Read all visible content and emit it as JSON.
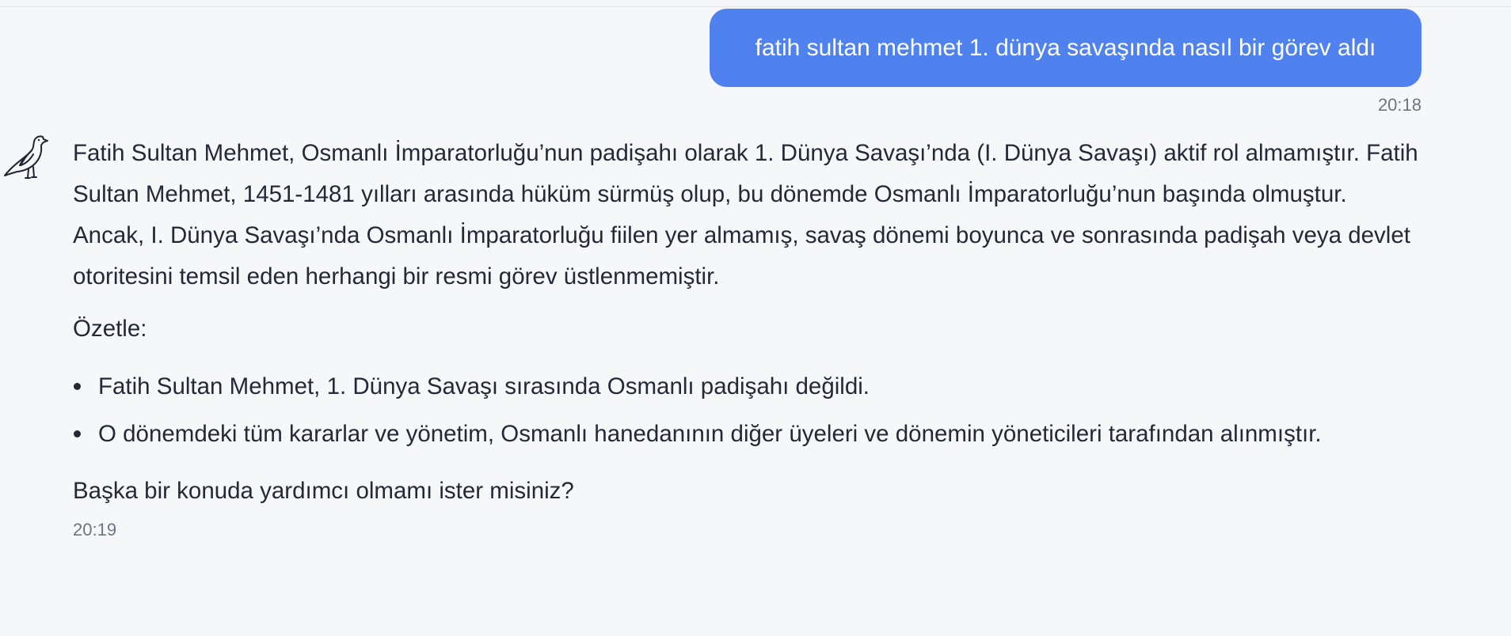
{
  "user_message": {
    "text": "fatih sultan mehmet 1. dünya savaşında nasıl bir görev aldı",
    "time": "20:18"
  },
  "assistant_message": {
    "avatar_icon": "bird-icon",
    "paragraph": "Fatih Sultan Mehmet, Osmanlı İmparatorluğu’nun padişahı olarak 1. Dünya Savaşı’nda (I. Dünya Savaşı) aktif rol almamıştır. Fatih Sultan Mehmet, 1451-1481 yılları arasında hüküm sürmüş olup, bu dönemde Osmanlı İmparatorluğu’nun başında olmuştur. Ancak, I. Dünya Savaşı’nda Osmanlı İmparatorluğu fiilen yer almamış, savaş dönemi boyunca ve sonrasında padişah veya devlet otoritesini temsil eden herhangi bir resmi görev üstlenmemiştir.",
    "summary_heading": "Özetle:",
    "bullets": [
      "Fatih Sultan Mehmet, 1. Dünya Savaşı sırasında Osmanlı padişahı değildi.",
      "O dönemdeki tüm kararlar ve yönetim, Osmanlı hanedanının diğer üyeleri ve dönemin yöneticileri tarafından alınmıştır."
    ],
    "closing": "Başka bir konuda yardımcı olmamı ister misiniz?",
    "time": "20:19"
  },
  "colors": {
    "background": "#f6f7f9",
    "user_bubble": "#4f82ee",
    "text": "#242936",
    "timestamp": "#6f7480"
  }
}
